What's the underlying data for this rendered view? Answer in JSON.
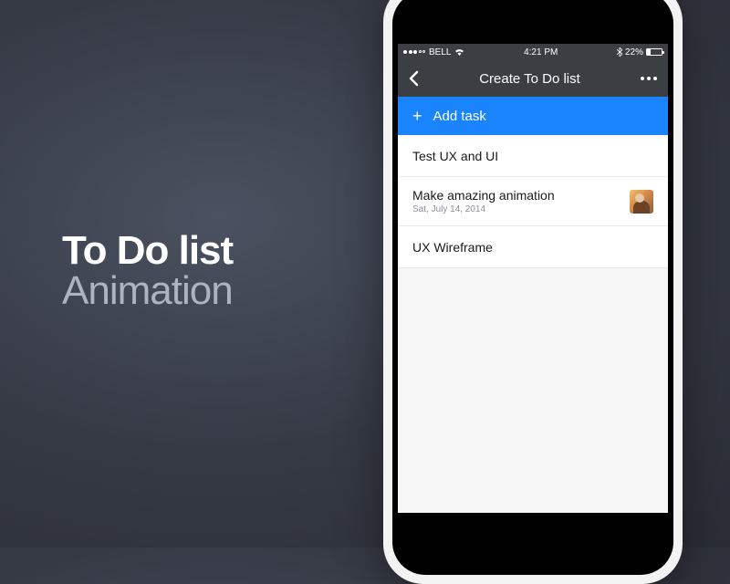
{
  "promo": {
    "title": "To Do list",
    "subtitle": "Animation"
  },
  "status_bar": {
    "carrier": "BELL",
    "time": "4:21 PM",
    "battery": "22%"
  },
  "nav": {
    "title": "Create To Do list"
  },
  "add_task": {
    "label": "Add task"
  },
  "tasks": [
    {
      "title": "Test UX and UI",
      "date": "",
      "has_avatar": false
    },
    {
      "title": "Make amazing animation",
      "date": "Sat, July 14, 2014",
      "has_avatar": true
    },
    {
      "title": "UX Wireframe",
      "date": "",
      "has_avatar": false
    }
  ]
}
